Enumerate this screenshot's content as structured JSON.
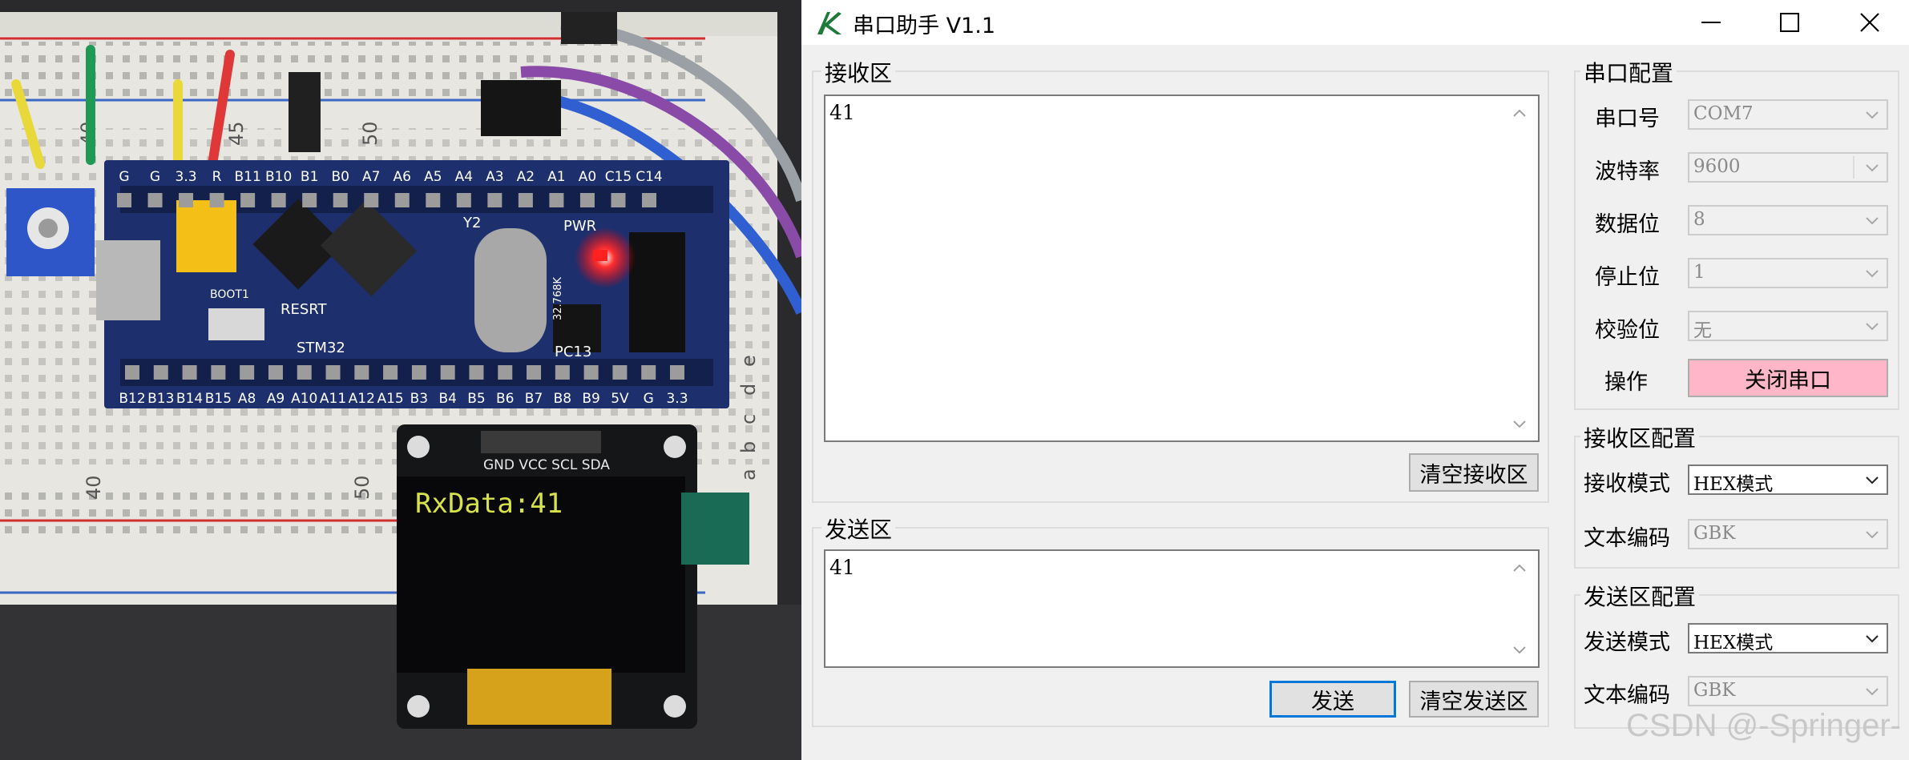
{
  "photo": {
    "board_header_top": [
      "G",
      "G",
      "3.3",
      "R",
      "B11",
      "B10",
      "B1",
      "B0",
      "A7",
      "A6",
      "A5",
      "A4",
      "A3",
      "A2",
      "A1",
      "A0",
      "C15",
      "C14"
    ],
    "board_header_bottom": [
      "B12",
      "B13",
      "B14",
      "B15",
      "A8",
      "A9",
      "A10",
      "A11",
      "A12",
      "A15",
      "B3",
      "B4",
      "B5",
      "B6",
      "B7",
      "B8",
      "B9",
      "5V",
      "G",
      "3.3"
    ],
    "board_labels": {
      "y2": "Y2",
      "pwr": "PWR",
      "resrt": "RESRT",
      "boot": "BOOT1",
      "chip": "STM32",
      "pc13": "PC13",
      "crystal": "32.768K"
    },
    "breadboard_numbers": {
      "n40_top": "40",
      "n45_top": "45",
      "n50_top": "50",
      "n40_bottom": "40",
      "n50_bottom": "50"
    },
    "breadboard_letters": [
      "a",
      "b",
      "c",
      "d",
      "e"
    ],
    "oled_pins": "GND VCC SCL SDA",
    "oled_text": "RxData:41"
  },
  "window": {
    "title": "串口助手 V1.1",
    "controls": {
      "minimize": "minimize",
      "maximize": "maximize",
      "close": "close"
    }
  },
  "receive": {
    "label": "接收区",
    "content": "41",
    "clear_button": "清空接收区"
  },
  "send": {
    "label": "发送区",
    "content": "41",
    "send_button": "发送",
    "clear_button": "清空发送区"
  },
  "serial_config": {
    "label": "串口配置",
    "port_label": "串口号",
    "port_value": "COM7",
    "baud_label": "波特率",
    "baud_value": "9600",
    "databits_label": "数据位",
    "databits_value": "8",
    "stopbits_label": "停止位",
    "stopbits_value": "1",
    "parity_label": "校验位",
    "parity_value": "无",
    "op_label": "操作",
    "op_button": "关闭串口"
  },
  "rx_config": {
    "label": "接收区配置",
    "mode_label": "接收模式",
    "mode_value": "HEX模式",
    "encoding_label": "文本编码",
    "encoding_value": "GBK"
  },
  "tx_config": {
    "label": "发送区配置",
    "mode_label": "发送模式",
    "mode_value": "HEX模式",
    "encoding_label": "文本编码",
    "encoding_value": "GBK"
  },
  "watermark": "CSDN @-Springer-"
}
